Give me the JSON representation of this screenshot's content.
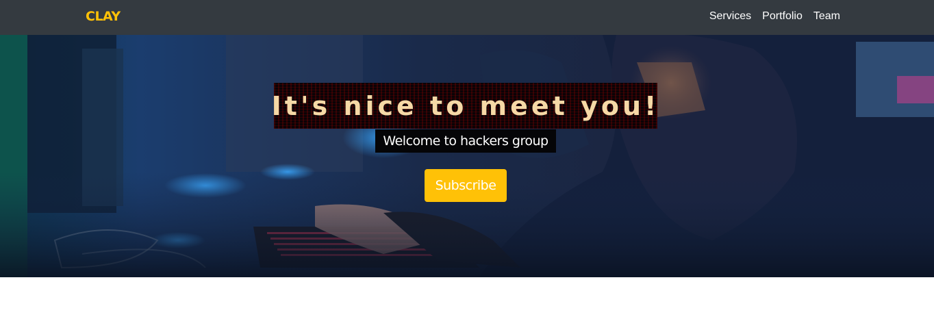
{
  "navbar": {
    "brand": "CLAY",
    "links": [
      {
        "label": "Services"
      },
      {
        "label": "Portfolio"
      },
      {
        "label": "Team"
      }
    ]
  },
  "hero": {
    "headline": "It's nice to meet you!",
    "subheadline": "Welcome to hackers group",
    "cta_label": "Subscribe"
  },
  "colors": {
    "navbar_bg": "#343a40",
    "brand": "#ffc107",
    "cta": "#ffc107",
    "headline_text": "#f6d9a6"
  }
}
